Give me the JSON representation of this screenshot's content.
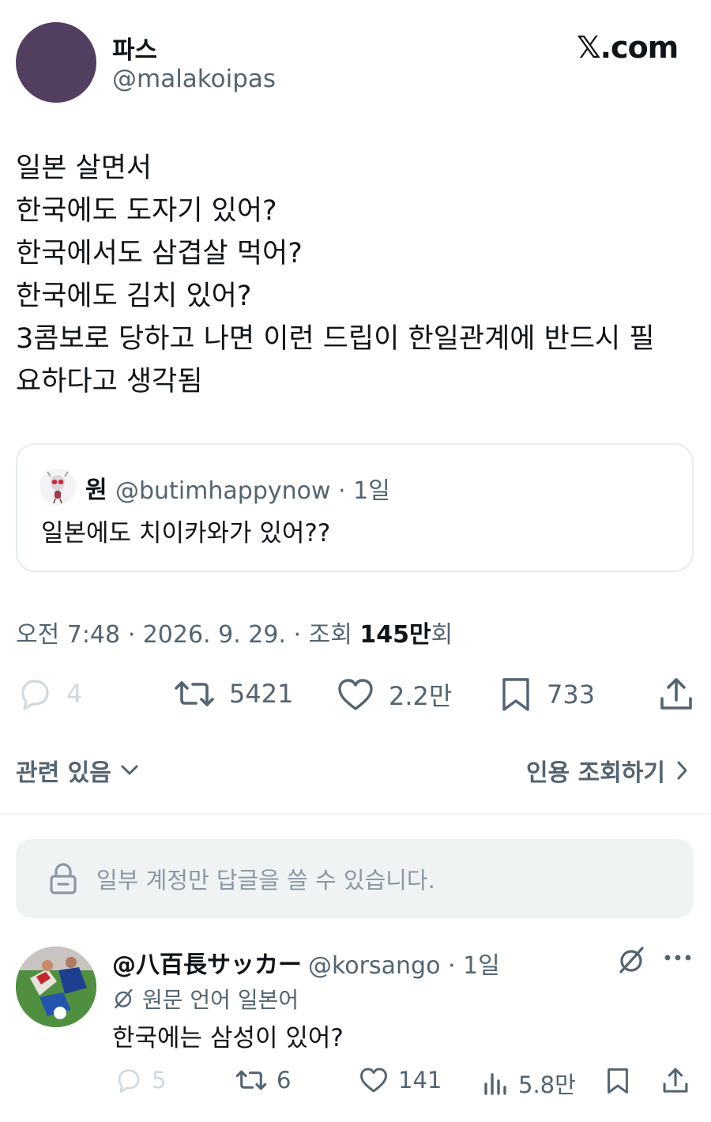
{
  "author": {
    "name": "파스",
    "handle": "@malakoipas"
  },
  "brand": "𝕏.com",
  "tweet": {
    "lines": [
      "일본 살면서",
      "한국에도 도자기 있어?",
      "한국에서도 삼겹살 먹어?",
      "한국에도 김치 있어?",
      "3콤보로 당하고 나면 이런 드립이 한일관계에 반드시 필",
      "요하다고 생각됨"
    ]
  },
  "quote": {
    "name": "원",
    "meta": "@butimhappynow · 1일",
    "text": "일본에도 치이카와가 있어??"
  },
  "meta": {
    "prefix": "오전 7:48 · 2026. 9. 29. · 조회 ",
    "views_bold": "145만",
    "suffix": "회"
  },
  "actions": {
    "replies": "4",
    "retweets": "5421",
    "likes": "2.2만",
    "bookmarks": "733"
  },
  "related": {
    "label": "관련 있음",
    "quote_views": "인용 조회하기"
  },
  "restricted": {
    "text": "일부 계정만 답글을 쓸 수 있습니다."
  },
  "reply": {
    "name": "@八百長サッカー",
    "handle": "@korsango · 1일",
    "lang": "원문 언어 일본어",
    "text": "한국에는 삼성이 있어?",
    "actions": {
      "replies": "5",
      "retweets": "6",
      "likes": "141",
      "views": "5.8만"
    }
  },
  "colors": {
    "accent_muted": "#536471",
    "avatar_main": "#523e5e"
  }
}
